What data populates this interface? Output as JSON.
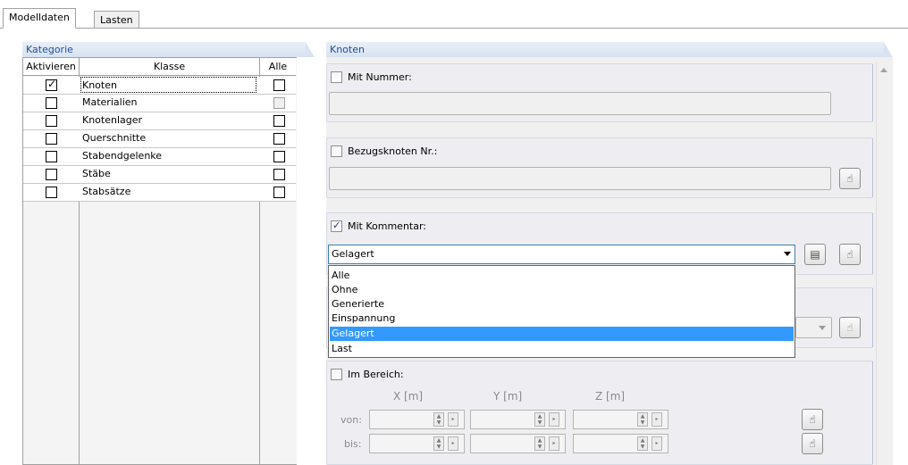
{
  "tabs": [
    {
      "label": "Modelldaten"
    },
    {
      "label": "Lasten"
    }
  ],
  "kategorie": {
    "title": "Kategorie",
    "headers": {
      "aktivieren": "Aktivieren",
      "klasse": "Klasse",
      "alle": "Alle"
    },
    "rows": [
      {
        "name": "Knoten",
        "active": true,
        "alle": false
      },
      {
        "name": "Materialien",
        "active": false,
        "alle": false
      },
      {
        "name": "Knotenlager",
        "active": false,
        "alle": false
      },
      {
        "name": "Querschnitte",
        "active": false,
        "alle": false
      },
      {
        "name": "Stabendgelenke",
        "active": false,
        "alle": false
      },
      {
        "name": "Stäbe",
        "active": false,
        "alle": false
      },
      {
        "name": "Stabsätze",
        "active": false,
        "alle": false
      }
    ]
  },
  "knoten": {
    "title": "Knoten",
    "mit_nummer": {
      "label": "Mit Nummer:",
      "checked": false,
      "value": ""
    },
    "bezugsknoten": {
      "label": "Bezugsknoten Nr.:",
      "checked": false,
      "value": ""
    },
    "mit_kommentar": {
      "label": "Mit Kommentar:",
      "checked": true,
      "value": "Gelagert"
    },
    "dropdown_options": [
      "Alle",
      "Ohne",
      "Generierte",
      "Einspannung",
      "Gelagert",
      "Last"
    ],
    "dropdown_selected": "Gelagert",
    "im_bereich": {
      "label": "Im Bereich:",
      "checked": false,
      "x_label": "X [m]",
      "y_label": "Y [m]",
      "z_label": "Z [m]",
      "von_label": "von:",
      "bis_label": "bis:"
    }
  },
  "icons": {
    "pick": "cursor-pick-icon",
    "edit": "edit-list-icon"
  }
}
